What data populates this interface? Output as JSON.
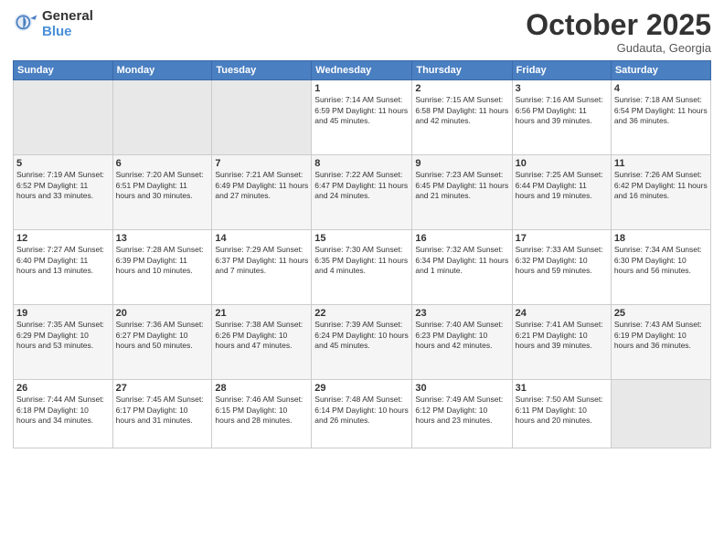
{
  "header": {
    "logo_general": "General",
    "logo_blue": "Blue",
    "month": "October 2025",
    "location": "Gudauta, Georgia"
  },
  "days_of_week": [
    "Sunday",
    "Monday",
    "Tuesday",
    "Wednesday",
    "Thursday",
    "Friday",
    "Saturday"
  ],
  "weeks": [
    [
      {
        "day": "",
        "info": ""
      },
      {
        "day": "",
        "info": ""
      },
      {
        "day": "",
        "info": ""
      },
      {
        "day": "1",
        "info": "Sunrise: 7:14 AM\nSunset: 6:59 PM\nDaylight: 11 hours and 45 minutes."
      },
      {
        "day": "2",
        "info": "Sunrise: 7:15 AM\nSunset: 6:58 PM\nDaylight: 11 hours and 42 minutes."
      },
      {
        "day": "3",
        "info": "Sunrise: 7:16 AM\nSunset: 6:56 PM\nDaylight: 11 hours and 39 minutes."
      },
      {
        "day": "4",
        "info": "Sunrise: 7:18 AM\nSunset: 6:54 PM\nDaylight: 11 hours and 36 minutes."
      }
    ],
    [
      {
        "day": "5",
        "info": "Sunrise: 7:19 AM\nSunset: 6:52 PM\nDaylight: 11 hours and 33 minutes."
      },
      {
        "day": "6",
        "info": "Sunrise: 7:20 AM\nSunset: 6:51 PM\nDaylight: 11 hours and 30 minutes."
      },
      {
        "day": "7",
        "info": "Sunrise: 7:21 AM\nSunset: 6:49 PM\nDaylight: 11 hours and 27 minutes."
      },
      {
        "day": "8",
        "info": "Sunrise: 7:22 AM\nSunset: 6:47 PM\nDaylight: 11 hours and 24 minutes."
      },
      {
        "day": "9",
        "info": "Sunrise: 7:23 AM\nSunset: 6:45 PM\nDaylight: 11 hours and 21 minutes."
      },
      {
        "day": "10",
        "info": "Sunrise: 7:25 AM\nSunset: 6:44 PM\nDaylight: 11 hours and 19 minutes."
      },
      {
        "day": "11",
        "info": "Sunrise: 7:26 AM\nSunset: 6:42 PM\nDaylight: 11 hours and 16 minutes."
      }
    ],
    [
      {
        "day": "12",
        "info": "Sunrise: 7:27 AM\nSunset: 6:40 PM\nDaylight: 11 hours and 13 minutes."
      },
      {
        "day": "13",
        "info": "Sunrise: 7:28 AM\nSunset: 6:39 PM\nDaylight: 11 hours and 10 minutes."
      },
      {
        "day": "14",
        "info": "Sunrise: 7:29 AM\nSunset: 6:37 PM\nDaylight: 11 hours and 7 minutes."
      },
      {
        "day": "15",
        "info": "Sunrise: 7:30 AM\nSunset: 6:35 PM\nDaylight: 11 hours and 4 minutes."
      },
      {
        "day": "16",
        "info": "Sunrise: 7:32 AM\nSunset: 6:34 PM\nDaylight: 11 hours and 1 minute."
      },
      {
        "day": "17",
        "info": "Sunrise: 7:33 AM\nSunset: 6:32 PM\nDaylight: 10 hours and 59 minutes."
      },
      {
        "day": "18",
        "info": "Sunrise: 7:34 AM\nSunset: 6:30 PM\nDaylight: 10 hours and 56 minutes."
      }
    ],
    [
      {
        "day": "19",
        "info": "Sunrise: 7:35 AM\nSunset: 6:29 PM\nDaylight: 10 hours and 53 minutes."
      },
      {
        "day": "20",
        "info": "Sunrise: 7:36 AM\nSunset: 6:27 PM\nDaylight: 10 hours and 50 minutes."
      },
      {
        "day": "21",
        "info": "Sunrise: 7:38 AM\nSunset: 6:26 PM\nDaylight: 10 hours and 47 minutes."
      },
      {
        "day": "22",
        "info": "Sunrise: 7:39 AM\nSunset: 6:24 PM\nDaylight: 10 hours and 45 minutes."
      },
      {
        "day": "23",
        "info": "Sunrise: 7:40 AM\nSunset: 6:23 PM\nDaylight: 10 hours and 42 minutes."
      },
      {
        "day": "24",
        "info": "Sunrise: 7:41 AM\nSunset: 6:21 PM\nDaylight: 10 hours and 39 minutes."
      },
      {
        "day": "25",
        "info": "Sunrise: 7:43 AM\nSunset: 6:19 PM\nDaylight: 10 hours and 36 minutes."
      }
    ],
    [
      {
        "day": "26",
        "info": "Sunrise: 7:44 AM\nSunset: 6:18 PM\nDaylight: 10 hours and 34 minutes."
      },
      {
        "day": "27",
        "info": "Sunrise: 7:45 AM\nSunset: 6:17 PM\nDaylight: 10 hours and 31 minutes."
      },
      {
        "day": "28",
        "info": "Sunrise: 7:46 AM\nSunset: 6:15 PM\nDaylight: 10 hours and 28 minutes."
      },
      {
        "day": "29",
        "info": "Sunrise: 7:48 AM\nSunset: 6:14 PM\nDaylight: 10 hours and 26 minutes."
      },
      {
        "day": "30",
        "info": "Sunrise: 7:49 AM\nSunset: 6:12 PM\nDaylight: 10 hours and 23 minutes."
      },
      {
        "day": "31",
        "info": "Sunrise: 7:50 AM\nSunset: 6:11 PM\nDaylight: 10 hours and 20 minutes."
      },
      {
        "day": "",
        "info": ""
      }
    ]
  ]
}
